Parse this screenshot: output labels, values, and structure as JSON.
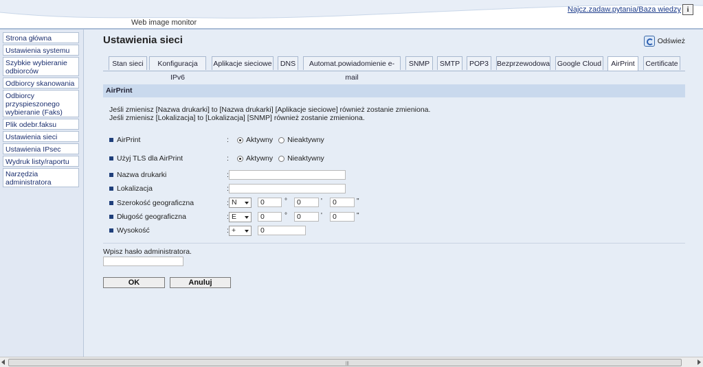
{
  "header": {
    "brand": "Web image monitor",
    "help_link": "Najcz.zadaw.pytania/Baza wiedzy",
    "info_icon": "i"
  },
  "sidebar": {
    "items": [
      {
        "label": "Strona główna"
      },
      {
        "label": "Ustawienia systemu"
      },
      {
        "label": "Szybkie wybieranie odbiorców"
      },
      {
        "label": "Odbiorcy skanowania"
      },
      {
        "label": "Odbiorcy przyspieszonego wybieranie (Faks)"
      },
      {
        "label": "Plik odebr.faksu"
      },
      {
        "label": "Ustawienia sieci"
      },
      {
        "label": "Ustawienia IPsec"
      },
      {
        "label": "Wydruk listy/raportu"
      },
      {
        "label": "Narzędzia administratora"
      }
    ]
  },
  "main": {
    "title": "Ustawienia sieci",
    "refresh_label": "Odśwież",
    "tabs": [
      {
        "label": "Stan sieci"
      },
      {
        "label": "Konfiguracja IPv6"
      },
      {
        "label": "Aplikacje sieciowe"
      },
      {
        "label": "DNS"
      },
      {
        "label": "Automat.powiadomienie e-mail"
      },
      {
        "label": "SNMP"
      },
      {
        "label": "SMTP"
      },
      {
        "label": "POP3"
      },
      {
        "label": "Bezprzewodowa"
      },
      {
        "label": "Google Cloud"
      },
      {
        "label": "AirPrint"
      },
      {
        "label": "Certificate"
      }
    ],
    "active_tab": "AirPrint",
    "section_title": "AirPrint",
    "notice_line1": "Jeśli zmienisz [Nazwa drukarki] to [Nazwa drukarki] [Aplikacje sieciowe] również zostanie zmieniona.",
    "notice_line2": "Jeśli zmienisz [Lokalizacja] to [Lokalizacja] [SNMP] również zostanie zmieniona."
  },
  "form": {
    "colon": ":",
    "airprint": {
      "label": "AirPrint",
      "option_on": "Aktywny",
      "option_off": "Nieaktywny",
      "selected": "Aktywny"
    },
    "tls": {
      "label": "Użyj TLS dla AirPrint",
      "option_on": "Aktywny",
      "option_off": "Nieaktywny",
      "selected": "Aktywny"
    },
    "printer_name": {
      "label": "Nazwa drukarki",
      "value": ""
    },
    "location": {
      "label": "Lokalizacja",
      "value": ""
    },
    "latitude": {
      "label": "Szerokość geograficzna",
      "direction": "N",
      "deg": "0",
      "min": "0",
      "sec": "0"
    },
    "longitude": {
      "label": "Długość geograficzna",
      "direction": "E",
      "deg": "0",
      "min": "0",
      "sec": "0"
    },
    "altitude": {
      "label": "Wysokość",
      "sign": "+",
      "value": "0"
    },
    "deg_symbol": "°",
    "min_symbol": "'",
    "sec_symbol": "\""
  },
  "password": {
    "label": "Wpisz hasło administratora.",
    "value": ""
  },
  "buttons": {
    "ok": "OK",
    "cancel": "Anuluj"
  },
  "scrollbar": {
    "grip": "|||"
  }
}
